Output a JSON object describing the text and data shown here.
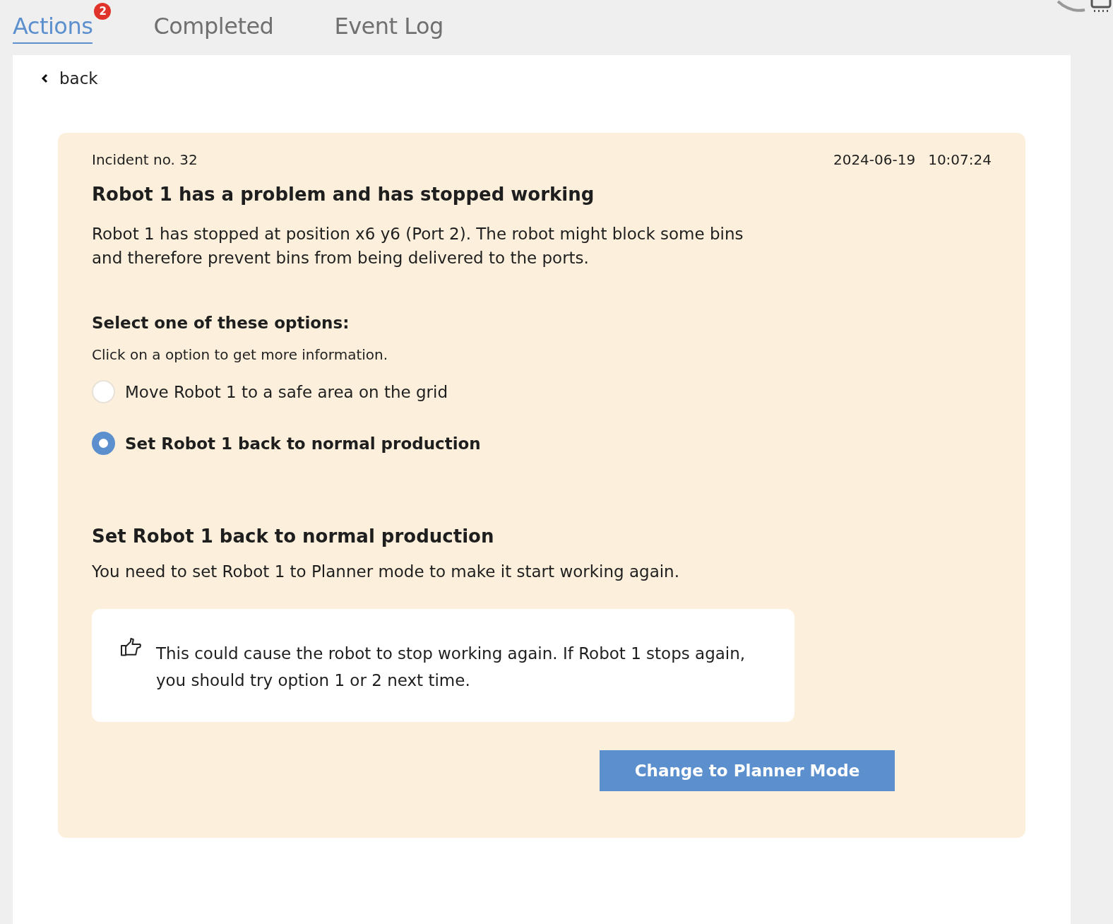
{
  "tabs": [
    {
      "label": "Actions",
      "selected": true,
      "badge": "2"
    },
    {
      "label": "Completed",
      "selected": false
    },
    {
      "label": "Event Log",
      "selected": false
    }
  ],
  "back": "back",
  "incident": {
    "number": "Incident no. 32",
    "date": "2024-06-19",
    "time": "10:07:24",
    "title": "Robot 1 has a problem and has stopped working",
    "description": "Robot 1 has stopped at position x6 y6 (Port 2). The robot might block some bins and therefore prevent bins from being delivered to the ports."
  },
  "options": {
    "heading": "Select one of these options:",
    "hint": "Click on a option to get more information.",
    "items": [
      {
        "label": "Move Robot 1 to a safe area on the grid",
        "selected": false
      },
      {
        "label": "Set Robot 1 back to normal production",
        "selected": true
      }
    ]
  },
  "detail": {
    "title": "Set Robot 1 back to normal production",
    "text": "You need to set Robot 1 to Planner mode to make it start working again.",
    "note": "This could cause the robot to stop working again. If Robot 1 stops again, you should try option 1 or 2 next time.",
    "button": "Change to Planner Mode"
  }
}
